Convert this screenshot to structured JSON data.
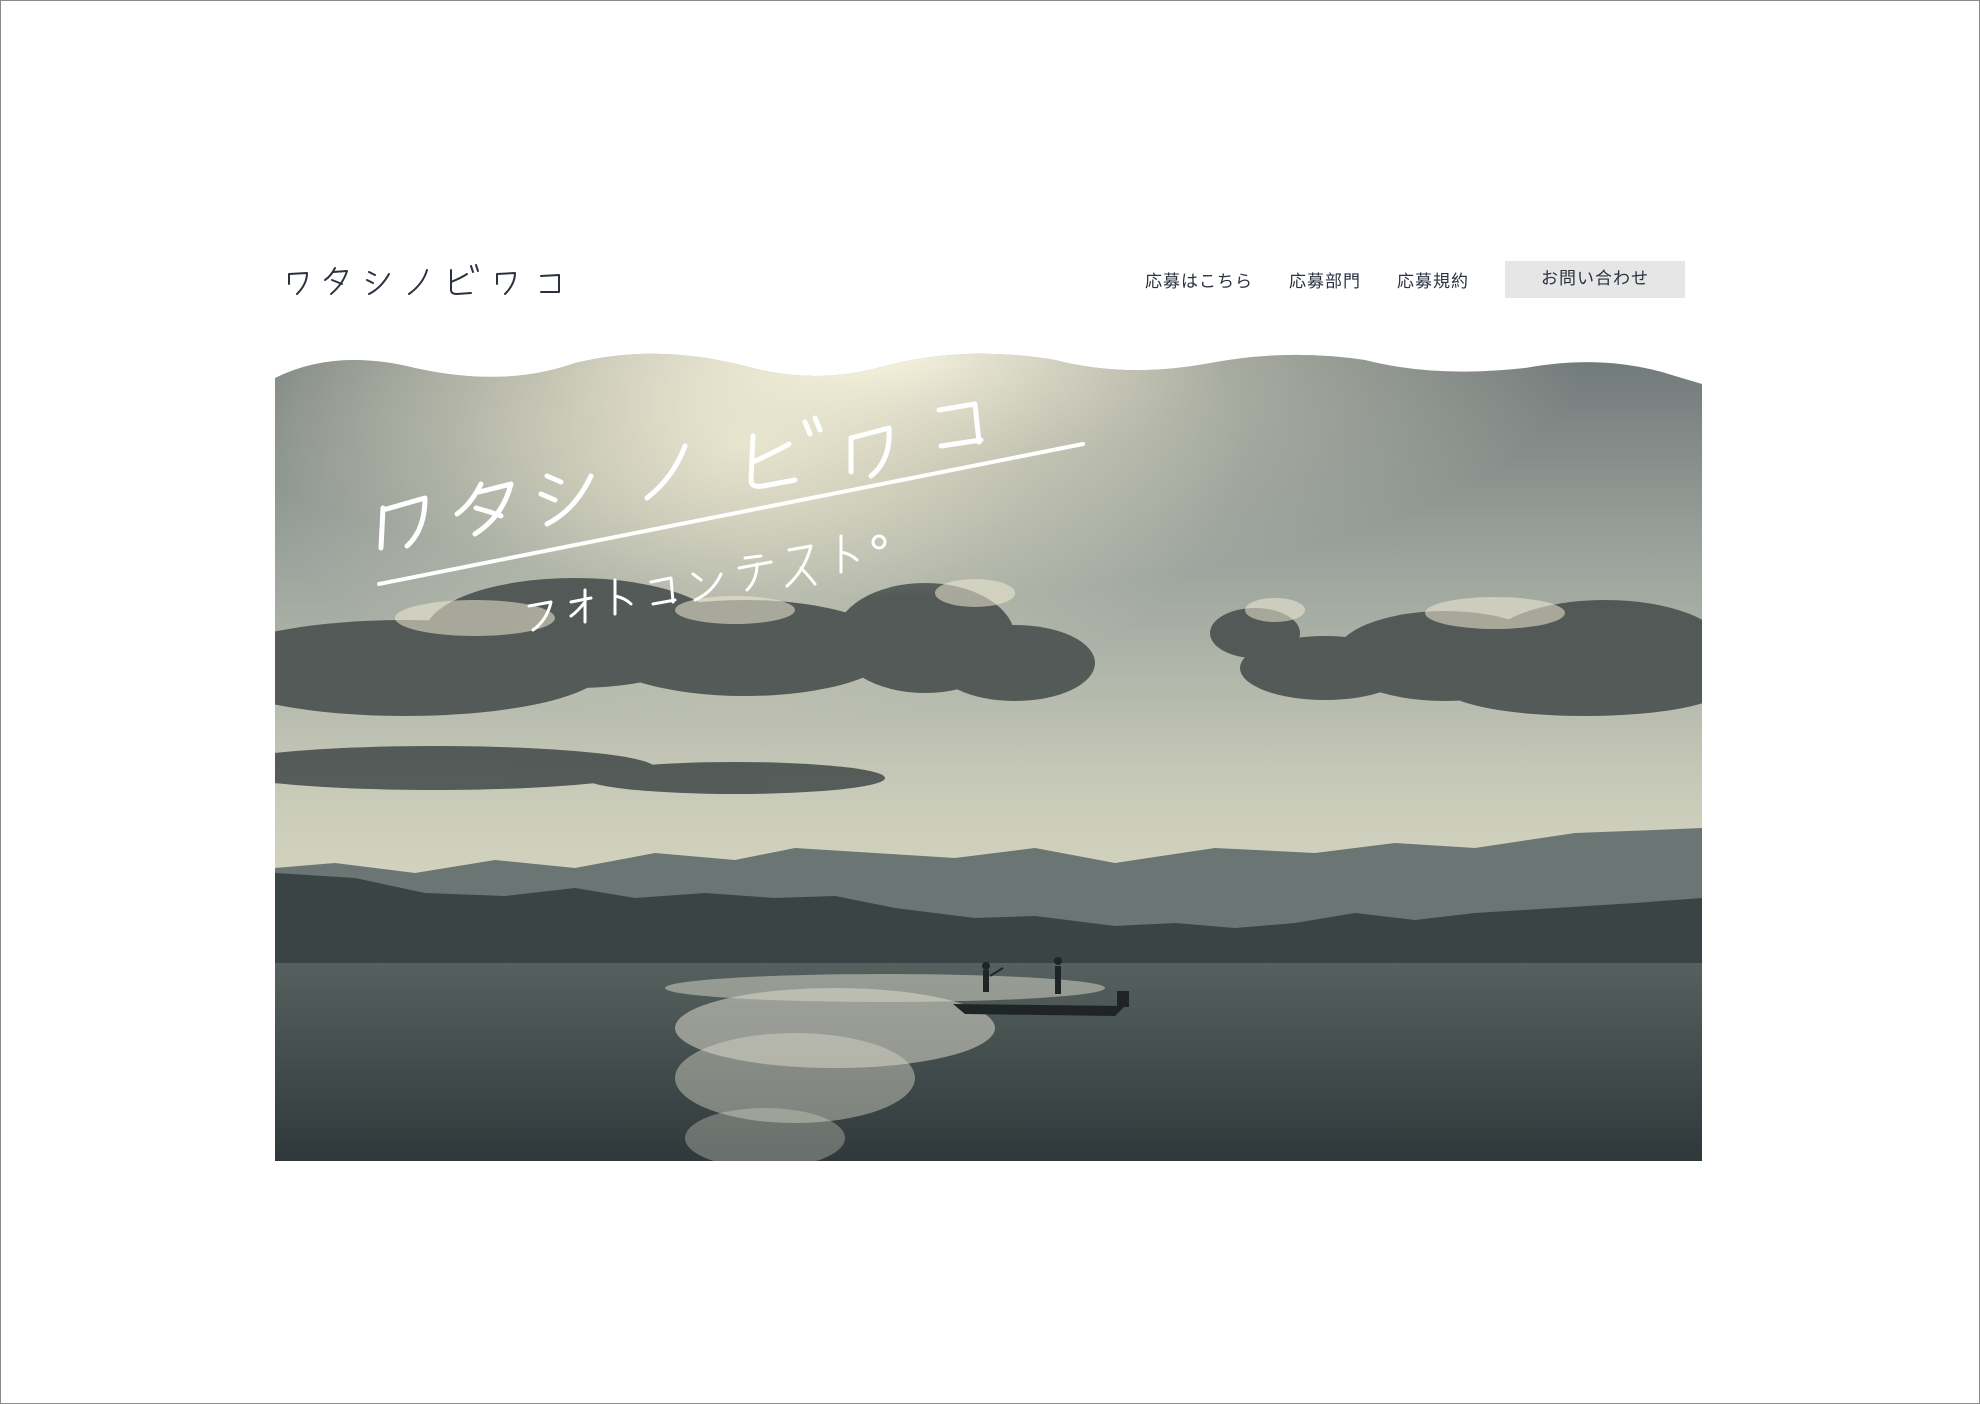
{
  "header": {
    "logo_text": "ワタシノビワコ",
    "nav": [
      {
        "label": "応募はこちら"
      },
      {
        "label": "応募部門"
      },
      {
        "label": "応募規約"
      },
      {
        "label": "お問い合わせ"
      }
    ]
  },
  "hero": {
    "title": "ワタシノビワコ",
    "subtitle": "フォトコンテスト。",
    "colors": {
      "sky_top": "#6f7878",
      "sky_mid": "#b9bdb0",
      "glow": "#f6f1d8",
      "cloud_dark": "#4b5250",
      "mountain": "#3a4445",
      "water": "#3b4648",
      "title_text": "#ffffff",
      "nav_text": "#2b3140",
      "contact_bg": "#e6e6e6"
    }
  }
}
